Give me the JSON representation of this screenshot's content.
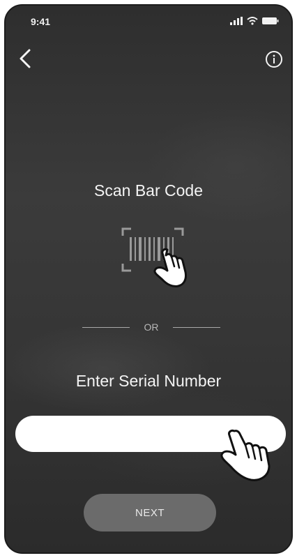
{
  "status_bar": {
    "time": "9:41",
    "icons": [
      "signal-icon",
      "wifi-icon",
      "battery-icon"
    ]
  },
  "nav": {
    "back_icon": "chevron-left-icon",
    "info_icon": "info-icon"
  },
  "scan": {
    "title": "Scan Bar Code",
    "icon": "barcode-scan-icon"
  },
  "divider": {
    "text": "OR"
  },
  "serial": {
    "title": "Enter Serial Number",
    "value": "",
    "placeholder": ""
  },
  "next_button": {
    "label": "NEXT"
  },
  "colors": {
    "background": "#333333",
    "text": "#f4f4f4",
    "button": "#6b6b6b",
    "input": "#ffffff"
  }
}
